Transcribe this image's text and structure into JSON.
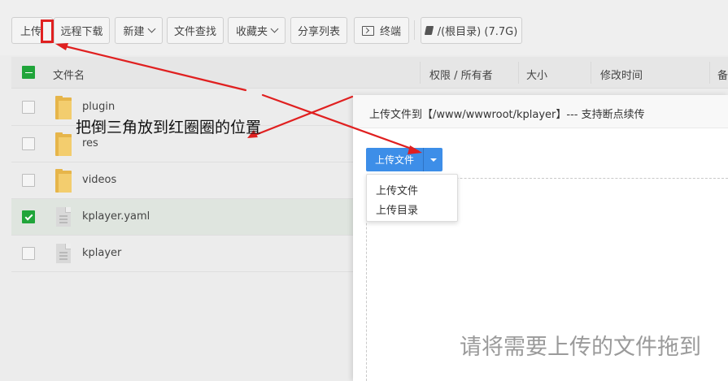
{
  "toolbar": {
    "upload_label": "上传",
    "remote_download_label": "远程下载",
    "new_label": "新建",
    "file_search_label": "文件查找",
    "favorites_label": "收藏夹",
    "share_list_label": "分享列表",
    "terminal_label": "终端",
    "disk_label": "/(根目录) (7.7G)"
  },
  "table": {
    "columns": [
      "文件名",
      "权限 / 所有者",
      "大小",
      "修改时间",
      "备"
    ],
    "rows": [
      {
        "name": "plugin",
        "type": "folder",
        "checked": false
      },
      {
        "name": "res",
        "type": "folder",
        "checked": false
      },
      {
        "name": "videos",
        "type": "folder",
        "checked": false
      },
      {
        "name": "kplayer.yaml",
        "type": "file",
        "checked": true
      },
      {
        "name": "kplayer",
        "type": "file",
        "checked": false
      }
    ]
  },
  "dialog": {
    "title": "上传文件到【/www/wwwroot/kplayer】--- 支持断点续传",
    "upload_button_label": "上传文件",
    "dropdown_items": [
      "上传文件",
      "上传目录"
    ],
    "dropzone_text": "请将需要上传的文件拖到"
  },
  "annotation": {
    "text": "把倒三角放到红圈圈的位置"
  },
  "colors": {
    "primary_blue": "#3d8ee8",
    "check_green": "#20a53a",
    "annotation_red": "#e02020",
    "folder_yellow": "#f3cd6e"
  }
}
